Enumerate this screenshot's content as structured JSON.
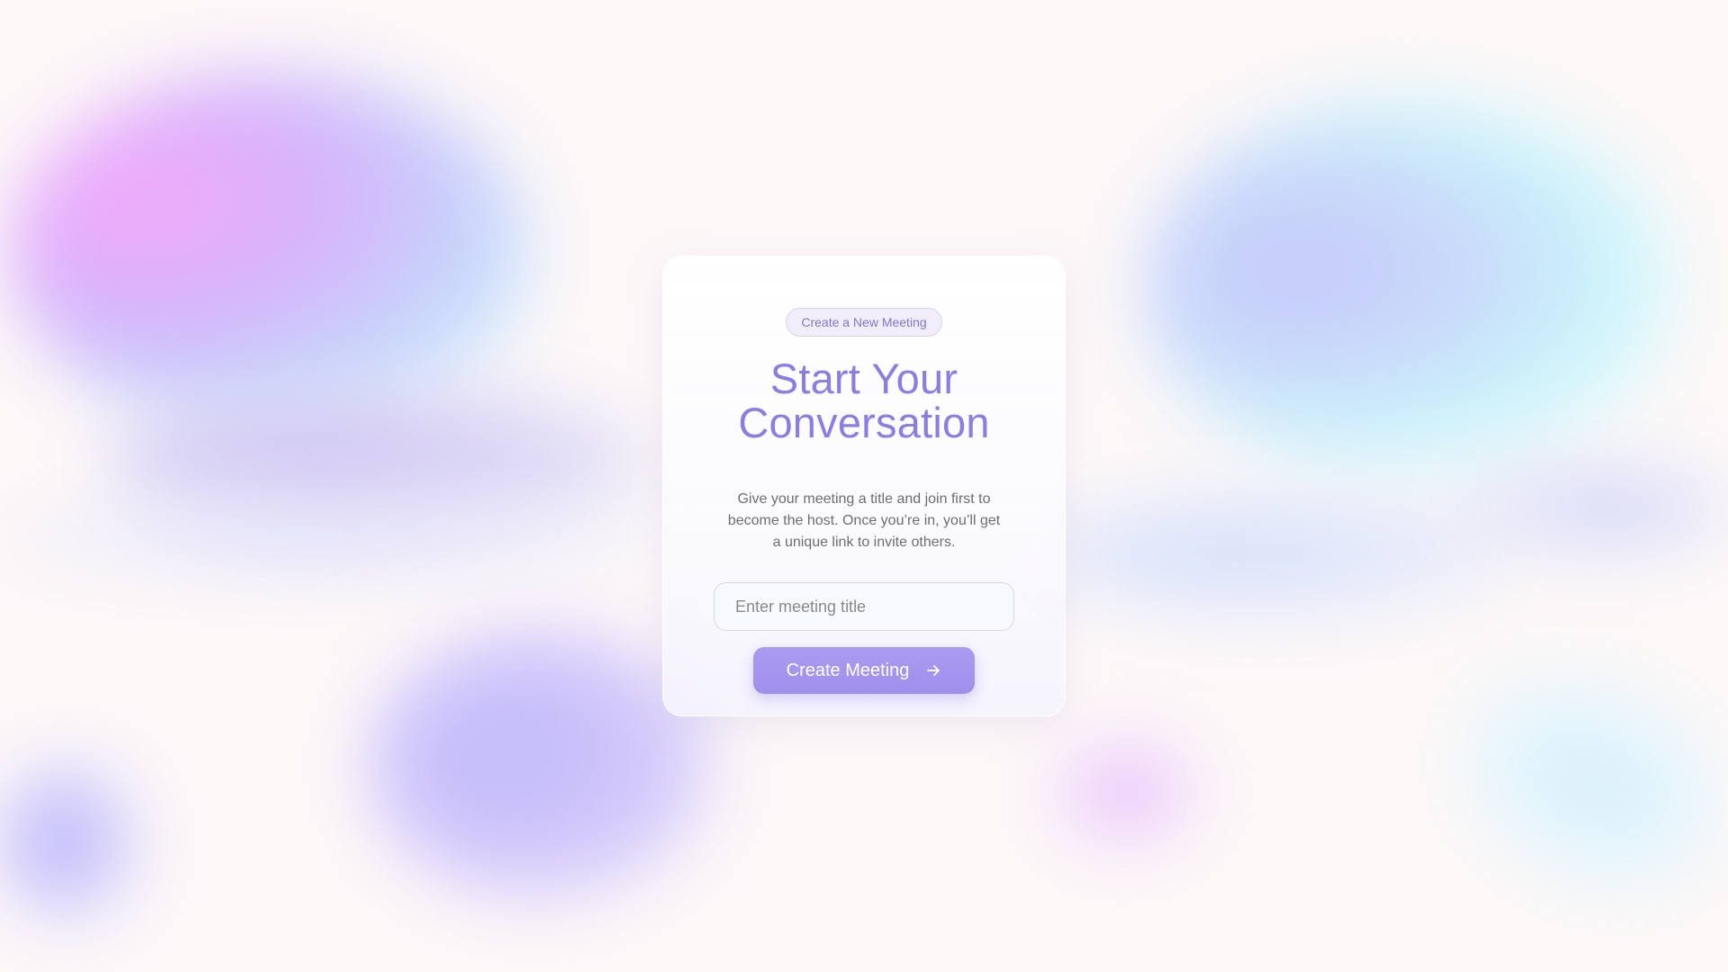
{
  "badge": {
    "label": "Create a New Meeting"
  },
  "heading": {
    "line1": "Start Your",
    "line2": "Conversation"
  },
  "description": "Give your meeting a title and join first to become the host. Once you’re in, you’ll get a unique link to invite others.",
  "meeting_title_input": {
    "placeholder": "Enter meeting title",
    "value": ""
  },
  "create_button": {
    "label": "Create Meeting",
    "icon": "arrow-right-icon"
  },
  "colors": {
    "accent": "#8a7ee6",
    "button": "#a394ee",
    "background": "#fdf8f8"
  }
}
